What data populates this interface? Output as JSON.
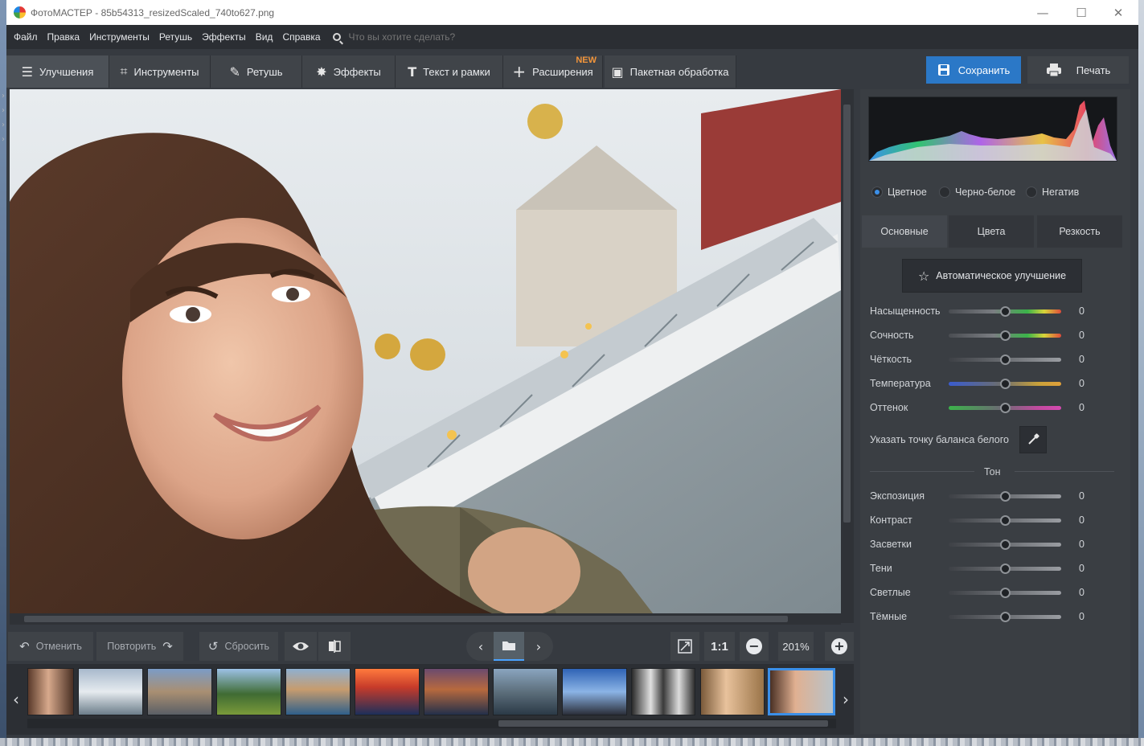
{
  "window": {
    "title": "ФотоМАСТЕР - 85b54313_resizedScaled_740to627.png",
    "controls": {
      "minimize": "—",
      "maximize": "☐",
      "close": "✕"
    }
  },
  "menu": {
    "items": [
      "Файл",
      "Правка",
      "Инструменты",
      "Ретушь",
      "Эффекты",
      "Вид",
      "Справка"
    ],
    "search_placeholder": "Что вы хотите сделать?"
  },
  "toolbar": {
    "tabs": [
      {
        "label": "Улучшения",
        "icon": "sliders-icon",
        "active": true
      },
      {
        "label": "Инструменты",
        "icon": "crop-icon",
        "active": false
      },
      {
        "label": "Ретушь",
        "icon": "brush-icon",
        "active": false
      },
      {
        "label": "Эффекты",
        "icon": "magic-wand-icon",
        "active": false
      },
      {
        "label": "Текст и рамки",
        "icon": "text-icon",
        "active": false
      },
      {
        "label": "Расширения",
        "icon": "plus-icon",
        "active": false,
        "badge": "NEW"
      },
      {
        "label": "Пакетная обработка",
        "icon": "batch-icon",
        "active": false
      }
    ],
    "save_label": "Сохранить",
    "print_label": "Печать"
  },
  "bottom_bar": {
    "undo_label": "Отменить",
    "redo_label": "Повторить",
    "reset_label": "Сбросить",
    "zoom_fit_label": "1:1",
    "zoom_value": "201%"
  },
  "filmstrip": {
    "thumbnails": [
      {
        "name": "portrait-brunette",
        "selected": false
      },
      {
        "name": "mountain-lake",
        "selected": false
      },
      {
        "name": "city-buildings",
        "selected": false
      },
      {
        "name": "green-hills",
        "selected": false
      },
      {
        "name": "coastal-town",
        "selected": false
      },
      {
        "name": "sunset-sky",
        "selected": false
      },
      {
        "name": "city-night",
        "selected": false
      },
      {
        "name": "harbor-city",
        "selected": false
      },
      {
        "name": "panorama-sky",
        "selected": false
      },
      {
        "name": "bw-portrait",
        "selected": false
      },
      {
        "name": "blonde-portrait",
        "selected": false
      },
      {
        "name": "selfie-boat",
        "selected": true
      }
    ]
  },
  "panel": {
    "modes": [
      {
        "label": "Цветное",
        "selected": true
      },
      {
        "label": "Черно-белое",
        "selected": false
      },
      {
        "label": "Негатив",
        "selected": false
      }
    ],
    "tabs": [
      {
        "label": "Основные",
        "active": true
      },
      {
        "label": "Цвета",
        "active": false
      },
      {
        "label": "Резкость",
        "active": false
      }
    ],
    "auto_enhance_label": "Автоматическое улучшение",
    "color_sliders": [
      {
        "label": "Насыщенность",
        "value": "0",
        "level": 0.5
      },
      {
        "label": "Сочность",
        "value": "0",
        "level": 0.5
      },
      {
        "label": "Чёткость",
        "value": "0",
        "level": 0.5
      },
      {
        "label": "Температура",
        "value": "0",
        "level": 0.5
      },
      {
        "label": "Оттенок",
        "value": "0",
        "level": 0.5
      }
    ],
    "white_balance_label": "Указать точку баланса белого",
    "tone_heading": "Тон",
    "tone_sliders": [
      {
        "label": "Экспозиция",
        "value": "0",
        "level": 0.5
      },
      {
        "label": "Контраст",
        "value": "0",
        "level": 0.5
      },
      {
        "label": "Засветки",
        "value": "0",
        "level": 0.5
      },
      {
        "label": "Тени",
        "value": "0",
        "level": 0.5
      },
      {
        "label": "Светлые",
        "value": "0",
        "level": 0.5
      },
      {
        "label": "Тёмные",
        "value": "0",
        "level": 0.5
      }
    ]
  },
  "colors": {
    "accent": "#2b78c7",
    "new_badge": "#f2953b",
    "selection": "#3b8fe8"
  }
}
